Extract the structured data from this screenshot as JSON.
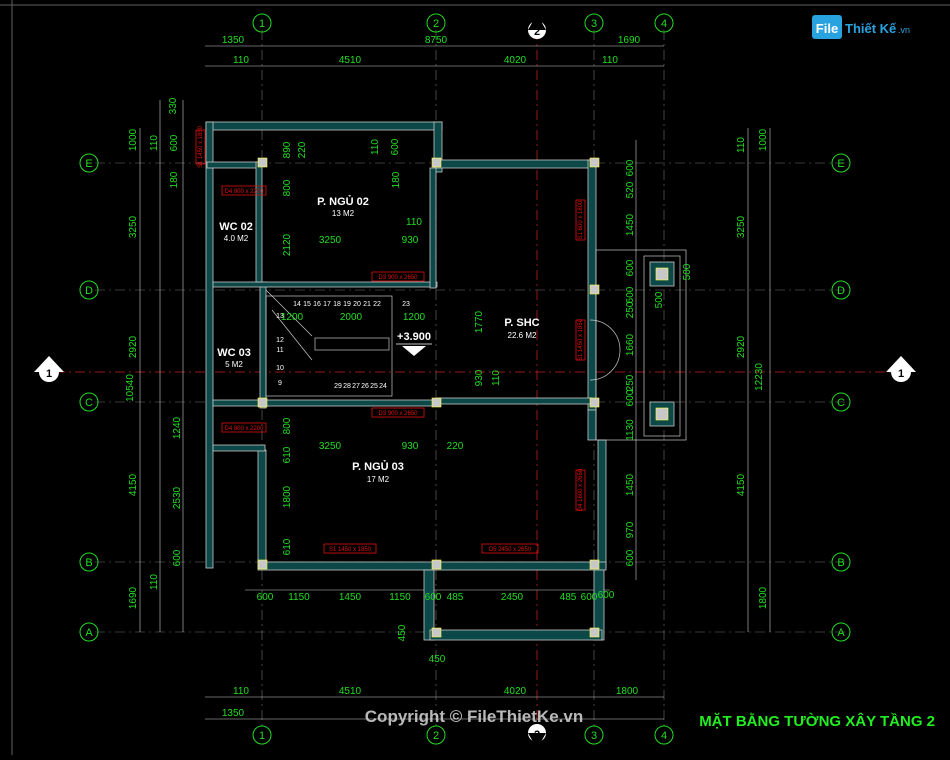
{
  "logo": {
    "part1": "File",
    "part2": "Thiết Kế",
    "part3": ".vn"
  },
  "watermark": "Copyright © FileThietKe.vn",
  "drawing_title": "MẶT BẰNG TƯỜNG XÂY TẦNG 2",
  "grid": {
    "columns": [
      "1",
      "2",
      "3",
      "4"
    ],
    "section_mark": "2",
    "rows": [
      "E",
      "D",
      "C",
      "B",
      "A"
    ],
    "section_side": "1"
  },
  "rooms": [
    {
      "name": "P. NGỦ 02",
      "area": "13 M2"
    },
    {
      "name": "WC 02",
      "area": "4.0 M2"
    },
    {
      "name": "WC 03",
      "area": "5 M2"
    },
    {
      "name": "P. SHC",
      "area": "22.6 M2"
    },
    {
      "name": "P. NGỦ 03",
      "area": "17 M2"
    }
  ],
  "level": "+3.900",
  "dims": {
    "top_outer": [
      "1350",
      "8750",
      "1690"
    ],
    "top_inner": [
      "110",
      "4510",
      "4020",
      "110"
    ],
    "bottom_inner": [
      "110",
      "4510",
      "4020",
      "1800"
    ],
    "bottom_outer": [
      "1350"
    ],
    "left_outer": [
      "1000",
      "3250",
      "2920",
      "4150",
      "1690"
    ],
    "left_total": "10540",
    "left_inner": [
      "330",
      "110",
      "600",
      "180",
      "1240",
      "2530",
      "600",
      "110"
    ],
    "right_outer": [
      "1000",
      "3250",
      "2920",
      "4150",
      "1800"
    ],
    "right_total": "12230",
    "right_inner": [
      "110",
      "600",
      "520",
      "600",
      "1450",
      "500",
      "600",
      "250",
      "1660",
      "250",
      "600",
      "1130",
      "1450",
      "970",
      "600"
    ],
    "bottom_row": [
      "600",
      "1150",
      "1450",
      "1150",
      "600",
      "485",
      "2450",
      "485",
      "600"
    ],
    "interior": [
      "890",
      "220",
      "110",
      "600",
      "180",
      "800",
      "110",
      "2120",
      "3250",
      "930",
      "1200",
      "2000",
      "1200",
      "1770",
      "930",
      "110",
      "800",
      "3250",
      "930",
      "220",
      "610",
      "1800",
      "610",
      "500",
      "450",
      "450",
      "600"
    ]
  },
  "door_tags": [
    "D4  800 x 2200",
    "D3  900 x 2650",
    "D4  800 x 2200",
    "D3  900 x 2650",
    "S1  1450 x 1850",
    "D5  2450 x 2650",
    "S1  600 x 1800",
    "S1  1450 x 1850",
    "D4  1600 x 2650",
    "S1  1450 x 1850"
  ],
  "stairs": {
    "top": [
      "14",
      "15",
      "16",
      "17",
      "18",
      "19",
      "20",
      "21",
      "22",
      "23"
    ],
    "left": [
      "13",
      "12",
      "11",
      "10",
      "9"
    ],
    "bottom": [
      "29",
      "28",
      "27",
      "26",
      "25",
      "24"
    ]
  }
}
